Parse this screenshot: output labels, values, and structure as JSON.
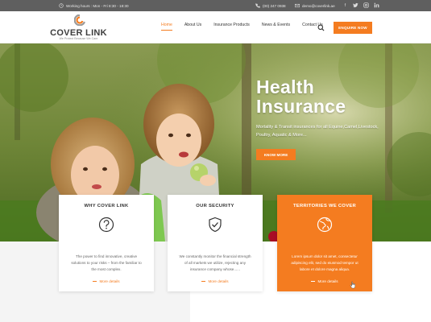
{
  "topbar": {
    "hours": "Working hours : Mon - Fri 8:30 - 18:30",
    "phone": "(00) 247 0938",
    "email": "demo@coverlink.ae",
    "social_icons": [
      "facebook-icon",
      "twitter-icon",
      "instagram-icon",
      "linkedin-icon"
    ]
  },
  "header": {
    "logo_name": "COVER LINK",
    "logo_tagline": "We Protect Because We Care",
    "nav": [
      "Home",
      "About Us",
      "Insurance Products",
      "News & Events",
      "Contact Us"
    ],
    "active_nav": "Home",
    "enquire_label": "ENQUIRE NOW"
  },
  "hero": {
    "title_line1": "Health",
    "title_line2": "Insurance",
    "description": "Mortality & Transit insurances for all Equine,Camel,Livestock, Poultry, Aquatic & More...",
    "cta_label": "KNOW MORE"
  },
  "cards": [
    {
      "title": "WHY COVER LINK",
      "icon": "question-icon",
      "text": "The power to find innovative, creative solutions to your risks – from the familiar to the most complex.",
      "more": "More details"
    },
    {
      "title": "OUR SECURITY",
      "icon": "shield-check-icon",
      "text": "We constantly monitor the financial strength of all markets we utilize, rejecting any insurance company whose......",
      "more": "More details"
    },
    {
      "title": "TERRITORIES WE COVER",
      "icon": "globe-icon",
      "text": "Lorem ipsum dolor sit amet, consectetur adipiscing elit, sed do eiusmod tempor ut labore et dolore magna aliqua.",
      "more": "More details"
    }
  ],
  "colors": {
    "accent": "#f47c20",
    "topbar": "#5f5f5f",
    "text": "#333333"
  }
}
